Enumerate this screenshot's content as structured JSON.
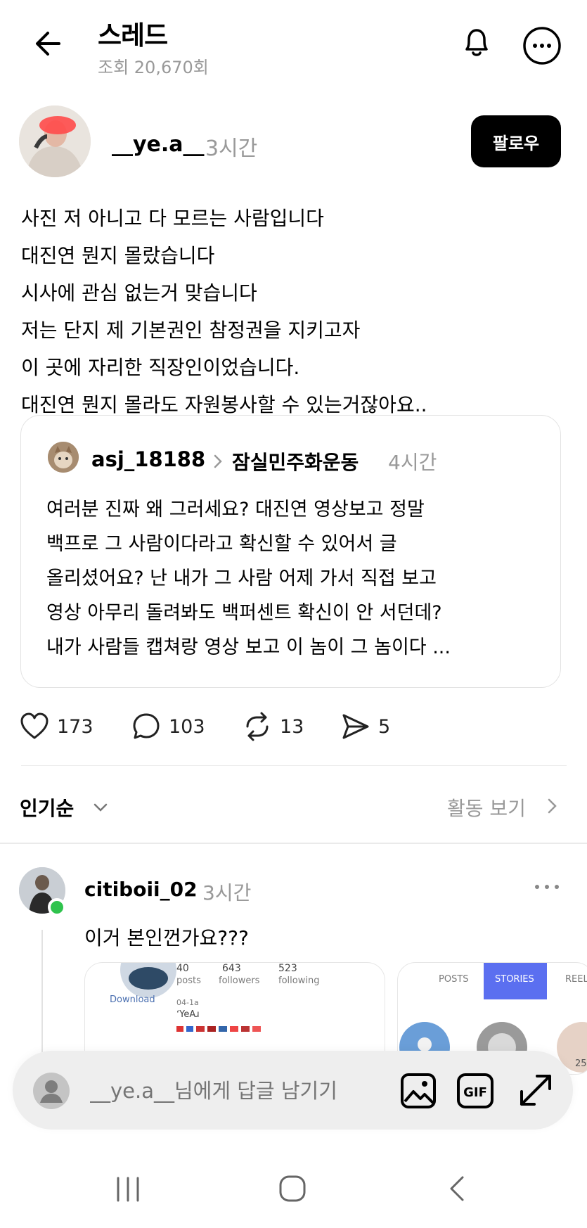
{
  "header": {
    "title": "스레드",
    "views": "조회 20,670회"
  },
  "post": {
    "author": "__ye.a__",
    "time": "3시간",
    "follow_label": "팔로우",
    "lines": [
      "사진 저 아니고 다 모르는 사람입니다",
      "대진연 뭔지 몰랐습니다",
      "시사에 관심 없는거 맞습니다",
      "저는 단지 제 기본권인 참정권을 지키고자",
      "이 곳에 자리한 직장인이었습니다.",
      "대진연 뭔지 몰라도 자원봉사할 수 있는거잖아요.."
    ]
  },
  "quote": {
    "author": "asj_18188",
    "community": "잠실민주화운동",
    "time": "4시간",
    "lines": [
      "여러분 진짜 왜 그러세요? 대진연 영상보고 정말",
      "백프로 그 사람이다라고 확신할 수 있어서 글",
      "올리셨어요? 난 내가 그 사람 어제 가서 직접 보고",
      "영상 아무리 돌려봐도 백퍼센트 확신이 안 서던데?",
      "내가 사람들 캡쳐랑 영상 보고 이 놈이 그 놈이다 ..."
    ]
  },
  "actions": {
    "likes": "173",
    "comments": "103",
    "reposts": "13",
    "shares": "5"
  },
  "sort": {
    "label": "인기순",
    "activity": "활동 보기"
  },
  "reply": {
    "author": "citiboii_02",
    "time": "3시간",
    "text": "이거 본인껀가요???",
    "image1": {
      "stat_posts": "40",
      "stat_posts_label": "posts",
      "stat_followers": "643",
      "stat_followers_label": "followers",
      "stat_following": "523",
      "stat_following_label": "following",
      "download": "Download",
      "bio_small": "04-1a",
      "bio_name": "ʻYeAɹ"
    },
    "image2": {
      "tab_posts": "POSTS",
      "tab_stories": "STORIES",
      "tab_reels": "REELS",
      "count": "25"
    }
  },
  "composer": {
    "placeholder": "__ye.a__님에게 답글 남기기"
  },
  "icons": {
    "back": "arrow-left-icon",
    "bell": "bell-icon",
    "more": "more-horizontal-icon",
    "heart": "heart-icon",
    "comment": "comment-icon",
    "repost": "repost-icon",
    "share": "send-icon",
    "photo": "image-icon",
    "gif": "gif-icon",
    "expand": "expand-icon"
  },
  "colors": {
    "online": "#2fc34d",
    "stories_tab": "#5b6ff0",
    "follow_bg": "#000000"
  }
}
